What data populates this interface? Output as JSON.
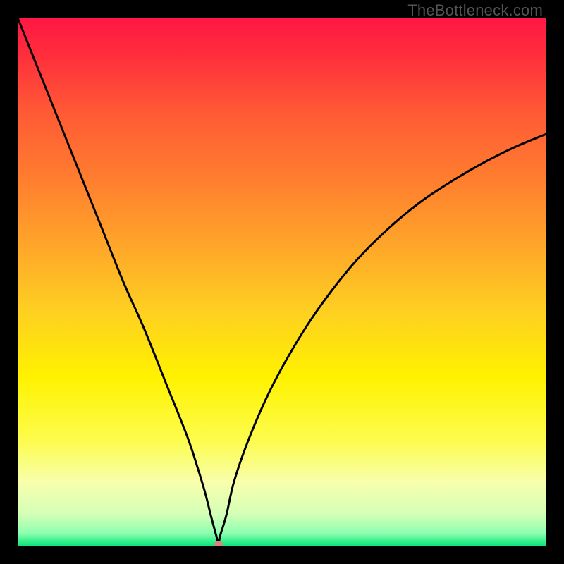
{
  "watermark": {
    "text": "TheBottleneck.com"
  },
  "chart_data": {
    "type": "line",
    "title": "",
    "xlabel": "",
    "ylabel": "",
    "xlim": [
      0,
      100
    ],
    "ylim": [
      0,
      100
    ],
    "background_gradient_stops": [
      {
        "offset": 0.0,
        "color": "#ff1744"
      },
      {
        "offset": 0.06,
        "color": "#ff2a3d"
      },
      {
        "offset": 0.18,
        "color": "#ff5a35"
      },
      {
        "offset": 0.3,
        "color": "#ff7c2f"
      },
      {
        "offset": 0.42,
        "color": "#ffa22a"
      },
      {
        "offset": 0.55,
        "color": "#fece22"
      },
      {
        "offset": 0.68,
        "color": "#fff200"
      },
      {
        "offset": 0.8,
        "color": "#fdfc4e"
      },
      {
        "offset": 0.88,
        "color": "#f7ffad"
      },
      {
        "offset": 0.94,
        "color": "#d3ffb7"
      },
      {
        "offset": 0.975,
        "color": "#8dffb0"
      },
      {
        "offset": 1.0,
        "color": "#00e676"
      }
    ],
    "series": [
      {
        "name": "bottleneck-curve",
        "color": "#000000",
        "width": 3,
        "x": [
          0,
          4,
          8,
          12,
          16,
          20,
          24,
          28,
          32,
          34,
          35.5,
          36.5,
          37.3,
          37.8,
          38,
          38.3,
          39.5,
          41,
          44,
          48,
          53,
          58,
          64,
          70,
          76,
          82,
          88,
          94,
          100
        ],
        "values": [
          100,
          90,
          80,
          70,
          60,
          50,
          41,
          31,
          21,
          15,
          10,
          6,
          3,
          1.2,
          0.3,
          2,
          6,
          12.5,
          21,
          30,
          39,
          46.5,
          54,
          60,
          65,
          69,
          72.5,
          75.5,
          78
        ]
      }
    ],
    "marker": {
      "x": 38,
      "y": 0.3,
      "color": "#d08a78",
      "rx": 7,
      "ry": 5
    }
  }
}
